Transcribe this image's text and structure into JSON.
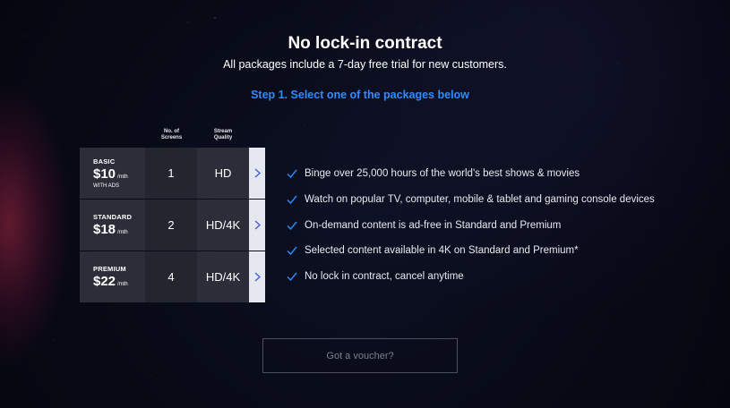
{
  "header": {
    "title": "No lock-in contract",
    "subtitle": "All packages include a 7-day free trial for new customers.",
    "step": "Step 1. Select one of the packages below"
  },
  "columns": {
    "screens_line1": "No. of",
    "screens_line2": "Screens",
    "quality_line1": "Stream",
    "quality_line2": "Quality"
  },
  "packages": [
    {
      "name": "BASIC",
      "price": "$10",
      "per": "/mth",
      "note": "WITH ADS",
      "screens": "1",
      "quality": "HD"
    },
    {
      "name": "STANDARD",
      "price": "$18",
      "per": "/mth",
      "note": "",
      "screens": "2",
      "quality": "HD/4K"
    },
    {
      "name": "PREMIUM",
      "price": "$22",
      "per": "/mth",
      "note": "",
      "screens": "4",
      "quality": "HD/4K"
    }
  ],
  "features": [
    "Binge over 25,000 hours of the world's best shows & movies",
    "Watch on popular TV, computer, mobile & tablet and gaming console devices",
    "On-demand content is ad-free in Standard and Premium",
    "Selected content available in 4K on Standard and Premium*",
    "No lock in contract, cancel anytime"
  ],
  "voucher": {
    "label": "Got a voucher?"
  },
  "colors": {
    "accent": "#2f8cff",
    "check": "#2f8cff",
    "arrow_bg": "#e6e8ef",
    "arrow": "#3b5bdb"
  },
  "icons": {
    "check": "check-icon",
    "arrow": "chevron-right-icon"
  }
}
